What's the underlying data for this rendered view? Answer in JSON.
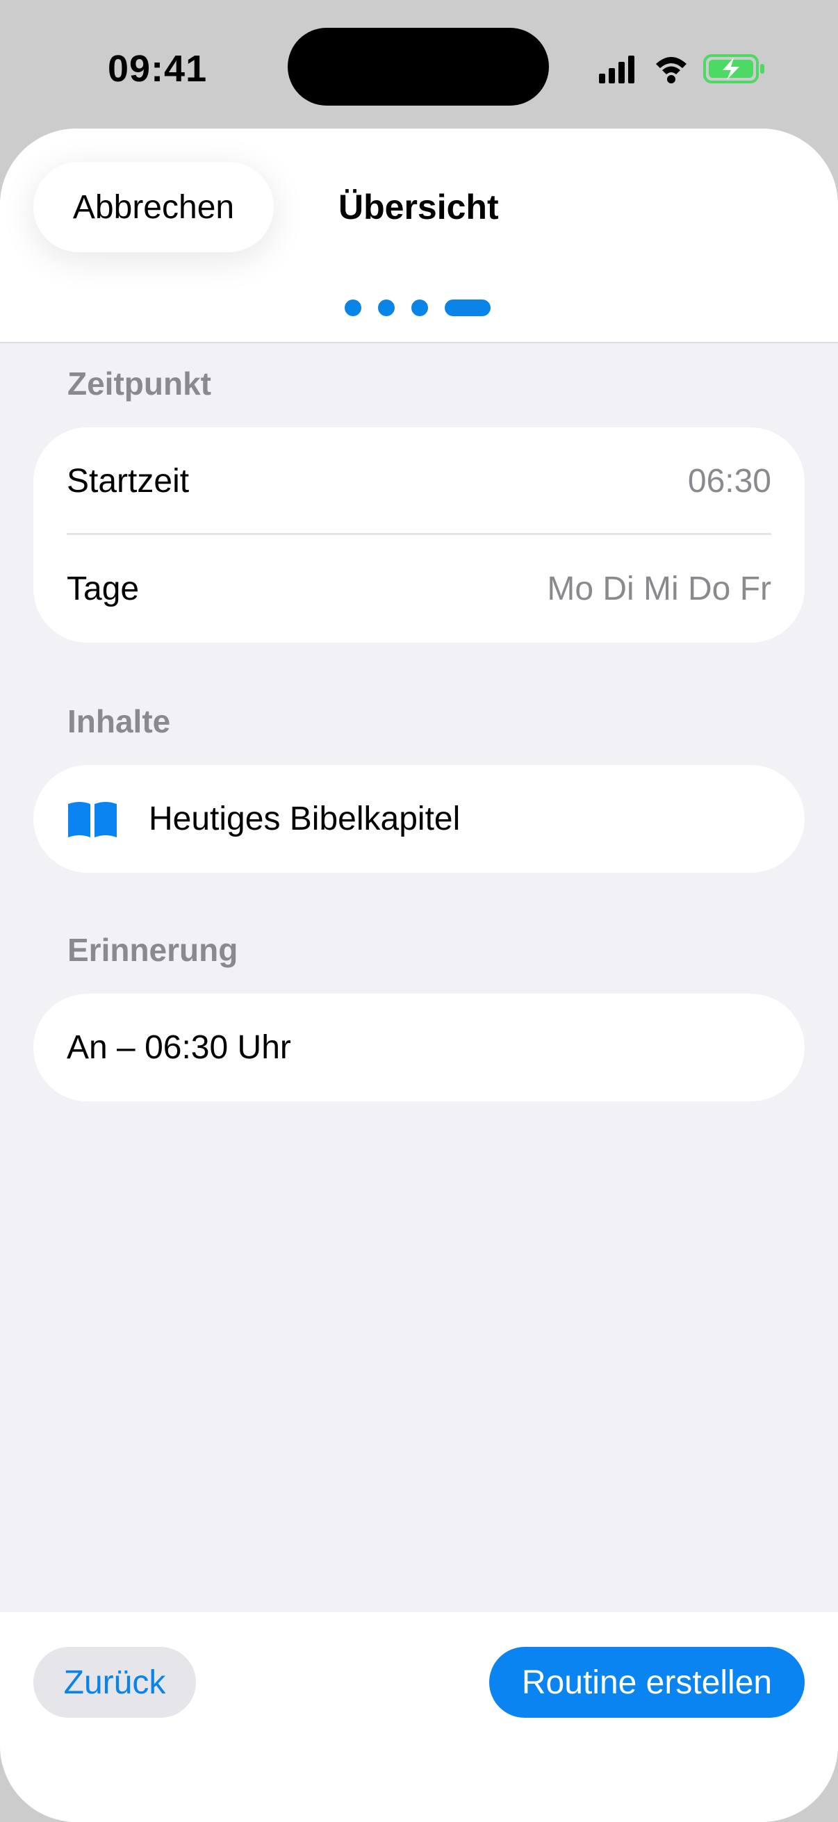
{
  "status_bar": {
    "time": "09:41",
    "icons": [
      "signal-icon",
      "wifi-icon",
      "battery-charging-icon"
    ]
  },
  "header": {
    "cancel_label": "Abbrechen",
    "title": "Übersicht",
    "steps_total": 4,
    "current_step": 4
  },
  "sections": {
    "zeitpunkt": {
      "label": "Zeitpunkt",
      "rows": [
        {
          "label": "Startzeit",
          "value": "06:30"
        },
        {
          "label": "Tage",
          "value": "Mo Di Mi Do Fr"
        }
      ]
    },
    "inhalte": {
      "label": "Inhalte",
      "item": {
        "icon": "book-icon",
        "label": "Heutiges Bibelkapitel"
      }
    },
    "erinnerung": {
      "label": "Erinnerung",
      "value": "An – 06:30 Uhr"
    }
  },
  "footer": {
    "back_label": "Zurück",
    "create_label": "Routine erstellen"
  },
  "colors": {
    "accent": "#0a84f0",
    "secondary_text": "#8a8a8e",
    "background": "#f1f1f6",
    "battery": "#4cd964"
  }
}
